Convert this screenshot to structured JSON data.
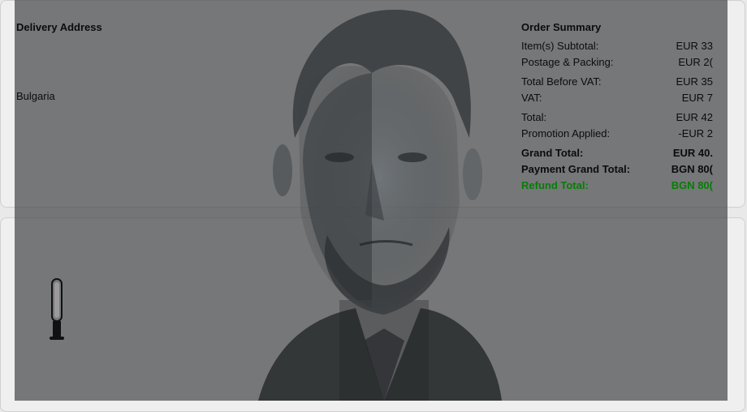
{
  "delivery": {
    "title": "Delivery Address",
    "country": "Bulgaria"
  },
  "order_summary": {
    "title": "Order Summary",
    "rows": [
      {
        "label": "Item(s) Subtotal:",
        "value": "EUR 33"
      },
      {
        "label": "Postage & Packing:",
        "value": "EUR 2("
      },
      {
        "label": "Total Before VAT:",
        "value": "EUR 35"
      },
      {
        "label": "VAT:",
        "value": "EUR 7"
      },
      {
        "label": "Total:",
        "value": "EUR 42"
      },
      {
        "label": "Promotion Applied:",
        "value": "-EUR 2"
      },
      {
        "label": "Grand Total:",
        "value": "EUR 40."
      },
      {
        "label": "Payment Grand Total:",
        "value": "BGN 80("
      },
      {
        "label": "Refund Total:",
        "value": "BGN 80("
      }
    ]
  },
  "product": {
    "icon": "tower-fan-icon"
  },
  "colors": {
    "refund_green": "#067d06",
    "overlay": "#46484a"
  }
}
